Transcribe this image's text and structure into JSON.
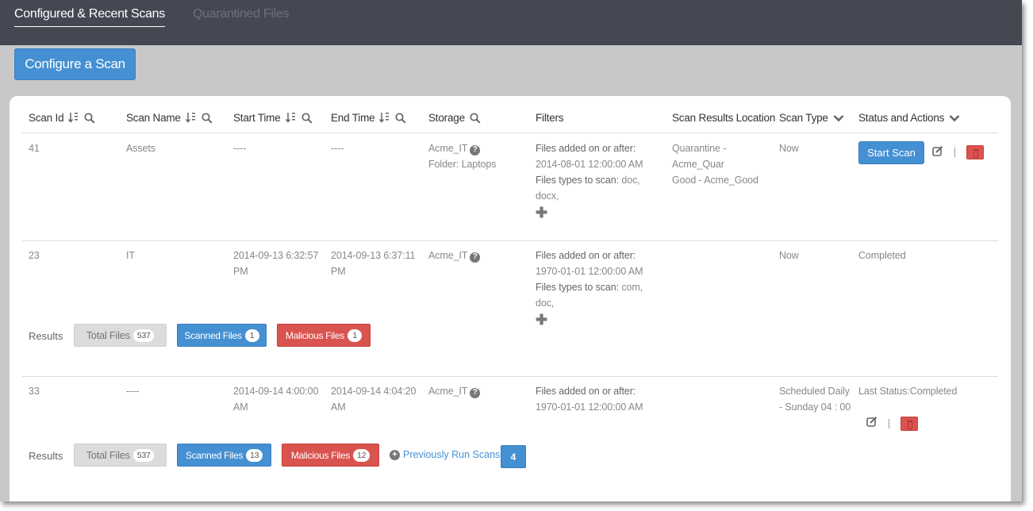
{
  "tabs": [
    {
      "label": "Configured & Recent Scans",
      "active": true
    },
    {
      "label": "Quarantined Files",
      "active": false
    }
  ],
  "configure_button": "Configure a Scan",
  "columns": {
    "scan_id": "Scan Id",
    "scan_name": "Scan Name",
    "start_time": "Start Time",
    "end_time": "End Time",
    "storage": "Storage",
    "filters": "Filters",
    "results_location": "Scan Results Location",
    "scan_type": "Scan Type",
    "status_actions": "Status and Actions"
  },
  "rows": [
    {
      "id": "41",
      "name": "Assets",
      "start_time": "----",
      "end_time": "----",
      "storage": "Acme_IT",
      "storage_folder": "Folder: Laptops",
      "filter_added_label": "Files added on or after:",
      "filter_added_value": "2014-08-01 12:00:00 AM",
      "filter_types_label": "Files types to scan:",
      "filter_types_value": "doc, docx,",
      "results_location": [
        "Quarantine - Acme_Quar",
        "Good - Acme_Good"
      ],
      "scan_type": "Now",
      "action_label": "Start Scan"
    },
    {
      "id": "23",
      "name": "IT",
      "start_time": "2014-09-13 6:32:57 PM",
      "end_time": "2014-09-13 6:37:11 PM",
      "storage": "Acme_IT",
      "filter_added_label": "Files added on or after:",
      "filter_added_value": "1970-01-01 12:00:00 AM",
      "filter_types_label": "Files types to scan:",
      "filter_types_value": "com, doc,",
      "scan_type": "Now",
      "status": "Completed",
      "results": {
        "label": "Results",
        "total_label": "Total Files",
        "total": "537",
        "scanned_label": "Scanned Files",
        "scanned": "1",
        "malicious_label": "Malicious Files",
        "malicious": "1"
      }
    },
    {
      "id": "33",
      "name": "----",
      "start_time": "2014-09-14 4:00:00 AM",
      "end_time": "2014-09-14 4:04:20 AM",
      "storage": "Acme_IT",
      "filter_added_label": "Files added on or after:",
      "filter_added_value": "1970-01-01 12:00:00 AM",
      "scan_type": "Scheduled Daily - Sunday 04 : 00",
      "status": "Last Status:Completed",
      "results": {
        "label": "Results",
        "total_label": "Total Files",
        "total": "537",
        "scanned_label": "Scanned Files",
        "scanned": "13",
        "malicious_label": "Malicious Files",
        "malicious": "12"
      },
      "previous_runs_label": "Previously Run Scans -",
      "previous_runs_count": "4"
    }
  ],
  "colors": {
    "topbar": "#454752",
    "primary": "#4590d2",
    "danger": "#d9534f",
    "background": "#c8c8c8"
  },
  "icons": [
    "sort-icon",
    "search-icon",
    "chevron-down-icon",
    "question-icon",
    "plus-icon",
    "edit-icon",
    "trash-icon",
    "plus-circle-icon"
  ]
}
